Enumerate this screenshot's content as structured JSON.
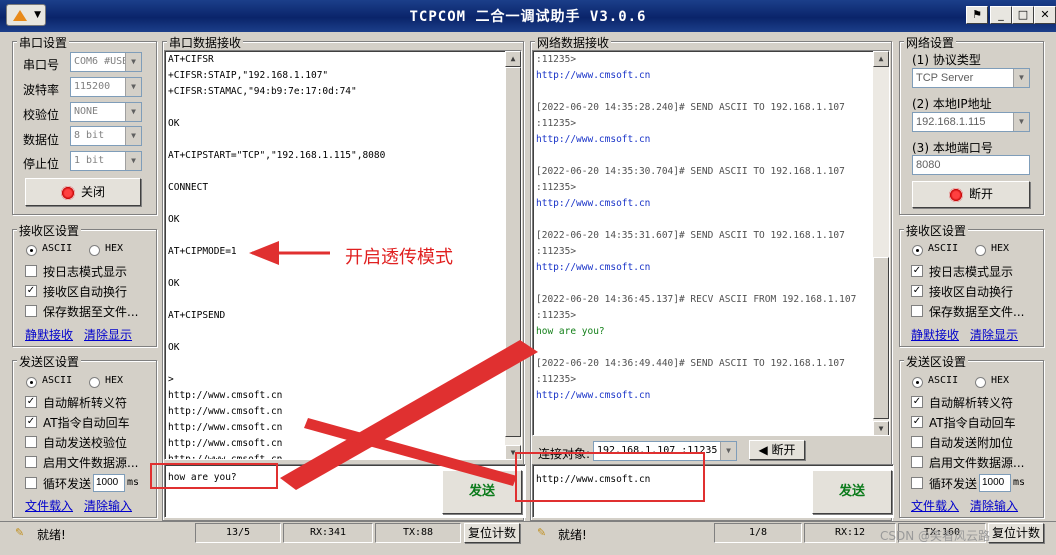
{
  "window": {
    "title": "TCPCOM  二合一调试助手  V3.0.6",
    "minimize": "_",
    "maximize": "□",
    "close": "✕"
  },
  "serial_settings": {
    "title": "串口设置",
    "port_label": "串口号",
    "port_value": "COM6 #USB",
    "baud_label": "波特率",
    "baud_value": "115200",
    "parity_label": "校验位",
    "parity_value": "NONE",
    "databits_label": "数据位",
    "databits_value": "8 bit",
    "stopbits_label": "停止位",
    "stopbits_value": "1 bit",
    "close_button": "关闭"
  },
  "left_recv": {
    "title": "接收区设置",
    "ascii": "ASCII",
    "hex": "HEX",
    "log_mode": "按日志模式显示",
    "auto_wrap": "接收区自动换行",
    "save_file": "保存数据至文件...",
    "silent_recv": "静默接收",
    "clear_display": "清除显示"
  },
  "left_send": {
    "title": "发送区设置",
    "ascii": "ASCII",
    "hex": "HEX",
    "auto_escape": "自动解析转义符",
    "at_return": "AT指令自动回车",
    "auto_checksum": "自动发送校验位",
    "file_source": "启用文件数据源...",
    "loop_send": "循环发送",
    "loop_value": "1000",
    "loop_unit": "ms",
    "load_file": "文件载入",
    "clear_input": "清除输入"
  },
  "serial_recv": {
    "title": "串口数据接收",
    "lines": [
      "AT+CIFSR",
      "+CIFSR:STAIP,\"192.168.1.107\"",
      "+CIFSR:STAMAC,\"94:b9:7e:17:0d:74\"",
      "",
      "OK",
      "",
      "AT+CIPSTART=\"TCP\",\"192.168.1.115\",8080",
      "",
      "CONNECT",
      "",
      "OK",
      "",
      "AT+CIPMODE=1",
      "",
      "OK",
      "",
      "AT+CIPSEND",
      "",
      "OK",
      "",
      ">",
      "http://www.cmsoft.cn",
      "http://www.cmsoft.cn",
      "http://www.cmsoft.cn",
      "http://www.cmsoft.cn",
      "http://www.cmsoft.cn"
    ],
    "send_input": "how are you?",
    "send_button": "发送"
  },
  "annotation": {
    "text": "开启透传模式"
  },
  "net_recv": {
    "title": "网络数据接收",
    "lines": [
      {
        "t": ":11235>",
        "c": "gray"
      },
      {
        "t": "http://www.cmsoft.cn",
        "c": "blue"
      },
      {
        "t": "",
        "c": "gray"
      },
      {
        "t": "[2022-06-20 14:35:28.240]# SEND ASCII TO 192.168.1.107",
        "c": "gray"
      },
      {
        "t": ":11235>",
        "c": "gray"
      },
      {
        "t": "http://www.cmsoft.cn",
        "c": "blue"
      },
      {
        "t": "",
        "c": "gray"
      },
      {
        "t": "[2022-06-20 14:35:30.704]# SEND ASCII TO 192.168.1.107",
        "c": "gray"
      },
      {
        "t": ":11235>",
        "c": "gray"
      },
      {
        "t": "http://www.cmsoft.cn",
        "c": "blue"
      },
      {
        "t": "",
        "c": "gray"
      },
      {
        "t": "[2022-06-20 14:35:31.607]# SEND ASCII TO 192.168.1.107",
        "c": "gray"
      },
      {
        "t": ":11235>",
        "c": "gray"
      },
      {
        "t": "http://www.cmsoft.cn",
        "c": "blue"
      },
      {
        "t": "",
        "c": "gray"
      },
      {
        "t": "[2022-06-20 14:36:45.137]# RECV ASCII FROM 192.168.1.107",
        "c": "gray"
      },
      {
        "t": ":11235>",
        "c": "gray"
      },
      {
        "t": "how are you?",
        "c": "green"
      },
      {
        "t": "",
        "c": "gray"
      },
      {
        "t": "[2022-06-20 14:36:49.440]# SEND ASCII TO 192.168.1.107",
        "c": "gray"
      },
      {
        "t": ":11235>",
        "c": "gray"
      },
      {
        "t": "http://www.cmsoft.cn",
        "c": "blue"
      }
    ],
    "conn_label": "连接对象:",
    "conn_value": "192.168.1.107 :11235",
    "disconnect_button": "断开",
    "send_input": "http://www.cmsoft.cn",
    "send_button": "发送"
  },
  "net_settings": {
    "title": "网络设置",
    "proto_label": "(1) 协议类型",
    "proto_value": "TCP Server",
    "ip_label": "(2) 本地IP地址",
    "ip_value": "192.168.1.115",
    "port_label": "(3) 本地端口号",
    "port_value": "8080",
    "open_button": "断开"
  },
  "right_recv": {
    "title": "接收区设置",
    "ascii": "ASCII",
    "hex": "HEX",
    "log_mode": "按日志模式显示",
    "auto_wrap": "接收区自动换行",
    "save_file": "保存数据至文件...",
    "silent_recv": "静默接收",
    "clear_display": "清除显示"
  },
  "right_send": {
    "title": "发送区设置",
    "ascii": "ASCII",
    "hex": "HEX",
    "auto_escape": "自动解析转义符",
    "at_return": "AT指令自动回车",
    "auto_append": "自动发送附加位",
    "file_source": "启用文件数据源...",
    "loop_send": "循环发送",
    "loop_value": "1000",
    "loop_unit": "ms",
    "load_file": "文件载入",
    "clear_input": "清除输入"
  },
  "statusbar": {
    "left_ready": "就绪!",
    "left_count": "13/5",
    "left_rx": "RX:341",
    "left_tx": "TX:88",
    "left_reset": "复位计数",
    "right_ready": "就绪!",
    "right_count": "1/8",
    "right_rx": "RX:12",
    "right_tx": "TX:160",
    "right_reset": "复位计数"
  },
  "watermark": "CSDN @笑看风云路",
  "colors": {
    "titlebar": "#0a246a",
    "arrow": "#e03030",
    "link_blue": "#1a34c8",
    "recv_green": "#14801a"
  }
}
